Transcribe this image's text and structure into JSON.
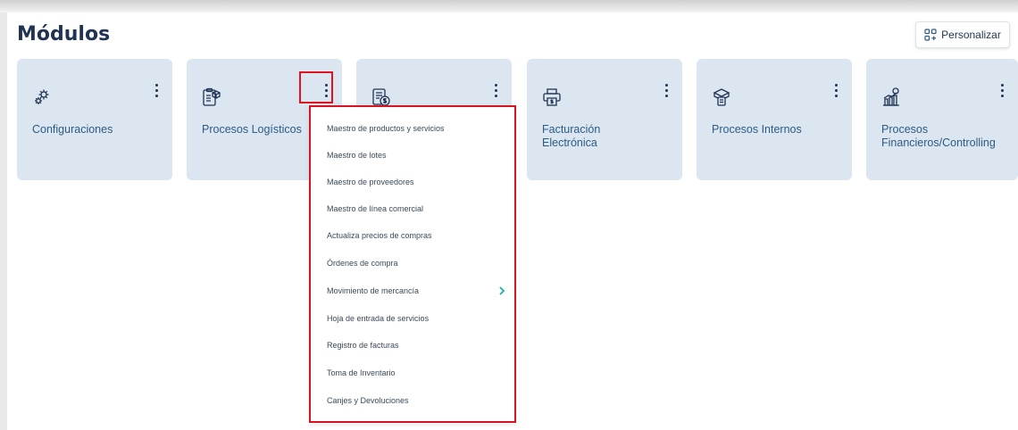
{
  "header": {
    "title": "Módulos"
  },
  "toolbar": {
    "personalizar_label": "Personalizar",
    "personalizar_icon": "grid-plus-icon"
  },
  "modules": [
    {
      "label": "Configuraciones",
      "icon": "gears-icon"
    },
    {
      "label": "Procesos Logísticos",
      "icon": "clipboard-box-icon"
    },
    {
      "label": "",
      "icon": "invoice-dollar-icon"
    },
    {
      "label": "Facturación Electrónica",
      "icon": "printer-dollar-icon"
    },
    {
      "label": "Procesos Internos",
      "icon": "box-document-icon"
    },
    {
      "label": "Procesos Financieros/Controlling",
      "icon": "bar-chart-dollar-icon"
    }
  ],
  "dropdown_menu": {
    "items": [
      {
        "label": "Maestro de productos y servicios"
      },
      {
        "label": "Maestro de lotes"
      },
      {
        "label": "Maestro de proveedores"
      },
      {
        "label": "Maestro de línea comercial"
      },
      {
        "label": "Actualiza precios de compras"
      },
      {
        "label": "Órdenes de compra"
      },
      {
        "label": "Movimiento de mercancía",
        "submenu": true
      },
      {
        "label": "Hoja de entrada de servicios"
      },
      {
        "label": "Registro de facturas"
      },
      {
        "label": "Toma de Inventario"
      },
      {
        "label": "Canjes y Devoluciones"
      }
    ]
  },
  "colors": {
    "title": "#1f3353",
    "card_bg": "#dbe6f1",
    "card_label": "#2d5b82",
    "highlight": "#e0141e",
    "chevron": "#17b3a3"
  }
}
